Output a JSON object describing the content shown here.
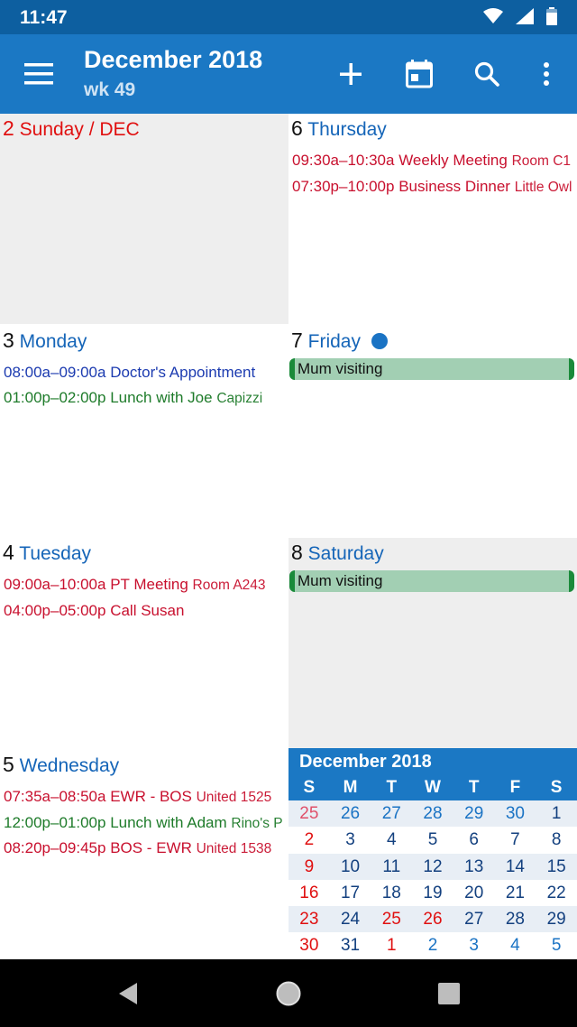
{
  "status_bar": {
    "time": "11:47",
    "icons": [
      "wifi-icon",
      "signal-icon",
      "battery-icon"
    ]
  },
  "toolbar": {
    "title": "December 2018",
    "subtitle": "wk 49",
    "icons": [
      "menu-icon",
      "add-icon",
      "today-calendar-icon",
      "search-icon",
      "more-vert-icon"
    ]
  },
  "days": {
    "sun2": {
      "num": "2",
      "name": "Sunday / DEC"
    },
    "mon3": {
      "num": "3",
      "name": "Monday",
      "events": [
        {
          "time": "08:00a–09:00a",
          "title": "Doctor's Appointment",
          "loc": ""
        },
        {
          "time": "01:00p–02:00p",
          "title": "Lunch with Joe",
          "loc": "Capizzi"
        }
      ]
    },
    "tue4": {
      "num": "4",
      "name": "Tuesday",
      "events": [
        {
          "time": "09:00a–10:00a",
          "title": "PT Meeting",
          "loc": "Room A243"
        },
        {
          "time": "04:00p–05:00p",
          "title": "Call Susan",
          "loc": ""
        }
      ]
    },
    "wed5": {
      "num": "5",
      "name": "Wednesday",
      "events": [
        {
          "time": "07:35a–08:50a",
          "title": "EWR - BOS",
          "loc": "United 1525"
        },
        {
          "time": "12:00p–01:00p",
          "title": "Lunch with Adam",
          "loc": "Rino's P"
        },
        {
          "time": "08:20p–09:45p",
          "title": "BOS - EWR",
          "loc": "United 1538"
        }
      ]
    },
    "thu6": {
      "num": "6",
      "name": "Thursday",
      "events": [
        {
          "time": "09:30a–10:30a",
          "title": "Weekly Meeting",
          "loc": "Room C1"
        },
        {
          "time": "07:30p–10:00p",
          "title": "Business Dinner",
          "loc": "Little Owl"
        }
      ]
    },
    "fri7": {
      "num": "7",
      "name": "Friday",
      "allday": "Mum visiting"
    },
    "sat8": {
      "num": "8",
      "name": "Saturday",
      "allday": "Mum visiting"
    }
  },
  "mini_calendar": {
    "title": "December 2018",
    "dows": [
      "S",
      "M",
      "T",
      "W",
      "T",
      "F",
      "S"
    ],
    "weeks": [
      [
        "25",
        "26",
        "27",
        "28",
        "29",
        "30",
        "1"
      ],
      [
        "2",
        "3",
        "4",
        "5",
        "6",
        "7",
        "8"
      ],
      [
        "9",
        "10",
        "11",
        "12",
        "13",
        "14",
        "15"
      ],
      [
        "16",
        "17",
        "18",
        "19",
        "20",
        "21",
        "22"
      ],
      [
        "23",
        "24",
        "25",
        "26",
        "27",
        "28",
        "29"
      ],
      [
        "30",
        "31",
        "1",
        "2",
        "3",
        "4",
        "5"
      ]
    ]
  },
  "nav_bar": {
    "icons": [
      "back-icon",
      "home-icon",
      "recents-icon"
    ]
  },
  "colors": {
    "appbar": "#1b78c4",
    "statusbar": "#0d5fa0",
    "sunday": "#e01010",
    "allday": "#a2cfb3"
  }
}
